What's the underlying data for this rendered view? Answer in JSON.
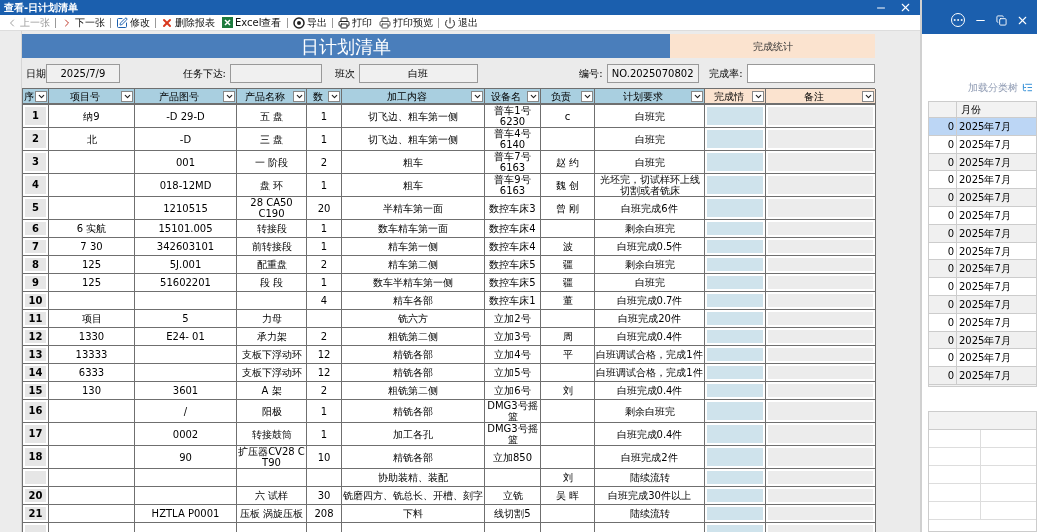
{
  "window": {
    "title": "查看-日计划清单"
  },
  "toolbar": [
    {
      "label": "上一张",
      "kind": "prev",
      "disabled": true
    },
    {
      "label": "下一张",
      "kind": "next",
      "disabled": false
    },
    {
      "label": "修改",
      "kind": "edit",
      "disabled": false
    },
    {
      "label": "删除报表",
      "kind": "delete",
      "disabled": false
    },
    {
      "label": "Excel查看",
      "kind": "excel",
      "disabled": false
    },
    {
      "label": "导出",
      "kind": "export",
      "disabled": false
    },
    {
      "label": "打印",
      "kind": "print",
      "disabled": false
    },
    {
      "label": "打印预览",
      "kind": "preview",
      "disabled": false
    },
    {
      "label": "退出",
      "kind": "exit",
      "disabled": false
    }
  ],
  "banner": {
    "title": "日计划清单",
    "stats_title": "完成统计"
  },
  "info": [
    {
      "label": "日期",
      "value": "2025/7/9",
      "kind": "plan"
    },
    {
      "label": "任务下达:",
      "kind": "plan"
    },
    {
      "label": "班次",
      "value": "白班",
      "kind": "plan"
    },
    {
      "label": "编号:",
      "value": "NO.2025070802",
      "kind": "plan"
    },
    {
      "label": "完成率:",
      "kind": "stats"
    }
  ],
  "table": {
    "columns": [
      {
        "label": "序",
        "kind": "plan"
      },
      {
        "label": "项目号",
        "kind": "plan"
      },
      {
        "label": "产品图号",
        "kind": "plan"
      },
      {
        "label": "产品名称",
        "kind": "plan"
      },
      {
        "label": "数",
        "kind": "plan"
      },
      {
        "label": "加工内容",
        "kind": "plan"
      },
      {
        "label": "设备名",
        "kind": "plan"
      },
      {
        "label": "负责",
        "kind": "plan"
      },
      {
        "label": "计划要求",
        "kind": "plan"
      },
      {
        "label": "完成情",
        "kind": "stats"
      },
      {
        "label": "备注",
        "kind": "stats"
      }
    ],
    "rows": [
      [
        "1",
        "纳9",
        "-D 29-D",
        "五 盘",
        "1",
        "切飞边、粗车第一侧",
        "普车1号 6230",
        "c",
        "白班完"
      ],
      [
        "2",
        "北",
        "-D",
        "三 盘",
        "1",
        "切飞边、粗车第一侧",
        "普车4号 6140",
        "",
        "白班完"
      ],
      [
        "3",
        "",
        "001",
        "一 阶段",
        "2",
        "粗车",
        "普车7号 6163",
        "赵 约",
        "白班完"
      ],
      [
        "4",
        "",
        "018-12MD",
        "盘 环",
        "1",
        "粗车",
        "普车9号 6163",
        "魏 创",
        "光坯完，切试样环上线切割或者铣床"
      ],
      [
        "5",
        "",
        "1210515",
        "28 CA50 C190",
        "20",
        "半精车第一面",
        "数控车床3",
        "曾 刚",
        "白班完成6件"
      ],
      [
        "6",
        "6 实航",
        "15101.005",
        "转接段",
        "1",
        "数车精车第一面",
        "数控车床4",
        "",
        "剩余白班完"
      ],
      [
        "7",
        "7 30",
        "342603101",
        "前转接段",
        "1",
        "精车第一侧",
        "数控车床4",
        "波",
        "白班完成0.5件"
      ],
      [
        "8",
        "125",
        "5J.001",
        "配重盘",
        "2",
        "精车第二侧",
        "数控车床5",
        "疆",
        "剩余白班完"
      ],
      [
        "9",
        "125",
        "51602201",
        "段 段",
        "1",
        "数车半精车第一侧",
        "数控车床5",
        "疆",
        "白班完"
      ],
      [
        "10",
        "",
        "",
        "",
        "4",
        "精车各部",
        "数控车床1",
        "董",
        "白班完成0.7件"
      ],
      [
        "11",
        "项目",
        "5",
        "力母",
        "",
        "铣六方",
        "立加2号",
        "",
        "白班完成20件"
      ],
      [
        "12",
        "1330",
        "E24- 01",
        "承力架",
        "2",
        "粗铣第二侧",
        "立加3号",
        "周",
        "白班完成0.4件"
      ],
      [
        "13",
        "13333",
        "",
        "支板下浮动环",
        "12",
        "精铣各部",
        "立加4号",
        "平",
        "白班调试合格，完成1件"
      ],
      [
        "14",
        "6333",
        "",
        "支板下浮动环",
        "12",
        "精铣各部",
        "立加5号",
        "",
        "白班调试合格，完成1件"
      ],
      [
        "15",
        "130",
        "3601",
        "A 架",
        "2",
        "粗铣第二侧",
        "立加6号",
        "刘",
        "白班完成0.4件"
      ],
      [
        "16",
        "",
        "/",
        "阳极",
        "1",
        "精铣各部",
        "DMG3号摇篮",
        "",
        "剩余白班完"
      ],
      [
        "17",
        "",
        "0002",
        "转接鼓筒",
        "1",
        "加工各孔",
        "DMG3号摇篮",
        "",
        "白班完成0.4件"
      ],
      [
        "18",
        "",
        "90",
        "扩压器CV28 C T90",
        "10",
        "精铣各部",
        "立加850",
        "",
        "白班完成2件"
      ],
      [
        "",
        "",
        "",
        "",
        "",
        "协助装精、装配",
        "",
        "刘",
        "陆续流转"
      ],
      [
        "20",
        "",
        "",
        "六 试样",
        "30",
        "铣磨四方、铣总长、开槽、刻字",
        "立铣",
        "吴 晖",
        "白班完成30件以上"
      ],
      [
        "21",
        "",
        "HZTLA P0001",
        "压板 涡旋压板",
        "208",
        "下料",
        "线切割5",
        "",
        "陆续流转"
      ],
      [
        "",
        "",
        "",
        "",
        "",
        "",
        "",
        "",
        ""
      ]
    ]
  },
  "side": {
    "link": "加载分类树",
    "column": "月份",
    "rows": [
      {
        "count": "0",
        "month": "2025年7月",
        "selected": true
      },
      {
        "count": "0",
        "month": "2025年7月",
        "selected": false
      },
      {
        "count": "0",
        "month": "2025年7月",
        "selected": false
      },
      {
        "count": "0",
        "month": "2025年7月",
        "selected": false
      },
      {
        "count": "0",
        "month": "2025年7月",
        "selected": false
      },
      {
        "count": "0",
        "month": "2025年7月",
        "selected": false
      },
      {
        "count": "0",
        "month": "2025年7月",
        "selected": false
      },
      {
        "count": "0",
        "month": "2025年7月",
        "selected": false
      },
      {
        "count": "0",
        "month": "2025年7月",
        "selected": false
      },
      {
        "count": "0",
        "month": "2025年7月",
        "selected": false
      },
      {
        "count": "0",
        "month": "2025年7月",
        "selected": false
      },
      {
        "count": "0",
        "month": "2025年7月",
        "selected": false
      },
      {
        "count": "0",
        "month": "2025年7月",
        "selected": false
      },
      {
        "count": "0",
        "month": "2025年7月",
        "selected": false
      },
      {
        "count": "0",
        "month": "2025年7月",
        "selected": false
      }
    ]
  }
}
